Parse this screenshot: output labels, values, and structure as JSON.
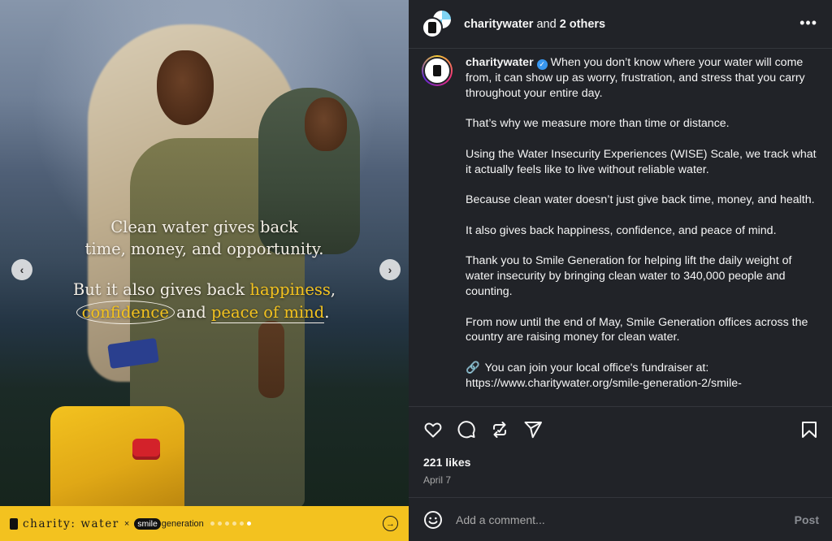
{
  "media": {
    "overlay_line1": "Clean water gives back",
    "overlay_line2": "time, money, and opportunity.",
    "overlay_line3_pre": "But it also gives back ",
    "overlay_hl1": "happiness",
    "overlay_line3_post": ",",
    "overlay_hl2": "confidence",
    "overlay_mid": " and ",
    "overlay_hl3": "peace of mind",
    "overlay_end": ".",
    "brand_name": "charity: water",
    "times_sign": "×",
    "partner_bubble": "smile",
    "partner_rest": "generation",
    "carousel_total": 6,
    "carousel_active": 6,
    "prev_arrow": "‹",
    "next_arrow": "›",
    "brand_arrow": "→",
    "colors": {
      "brand_yellow": "#f3c21f",
      "cap_red": "#d3222a"
    }
  },
  "header": {
    "username": "charitywater",
    "and_text": " and ",
    "others": "2 others",
    "more_icon": "•••"
  },
  "caption": {
    "username": "charitywater",
    "verified_glyph": "✓",
    "p1": "When you don’t know where your water will come from, it can show up as worry, frustration, and stress that you carry throughout your entire day.",
    "p2": "That’s why we measure more than time or distance.",
    "p3": "Using the Water Insecurity Experiences (WISE) Scale, we track what it actually feels like to live without reliable water.",
    "p4": "Because clean water doesn’t just give back time, money, and health.",
    "p5": "It also gives back happiness, confidence, and peace of mind.",
    "p6": "Thank you to Smile Generation for helping lift the daily weight of water insecurity by bringing clean water to 340,000 people and counting.",
    "p7": "From now until the end of May, Smile Generation offices across the country are raising money for clean water.",
    "p8_icon": "🔗",
    "p8": "You can join your local office's fundraiser at:",
    "p8_link": "https://www.charitywater.org/smile-generation-2/smile-"
  },
  "actions": {
    "icons": [
      "heart-icon",
      "comment-icon",
      "repost-icon",
      "share-icon",
      "bookmark-icon"
    ],
    "likes": "221 likes",
    "date": "April 7"
  },
  "comment": {
    "placeholder": "Add a comment...",
    "post_label": "Post"
  }
}
